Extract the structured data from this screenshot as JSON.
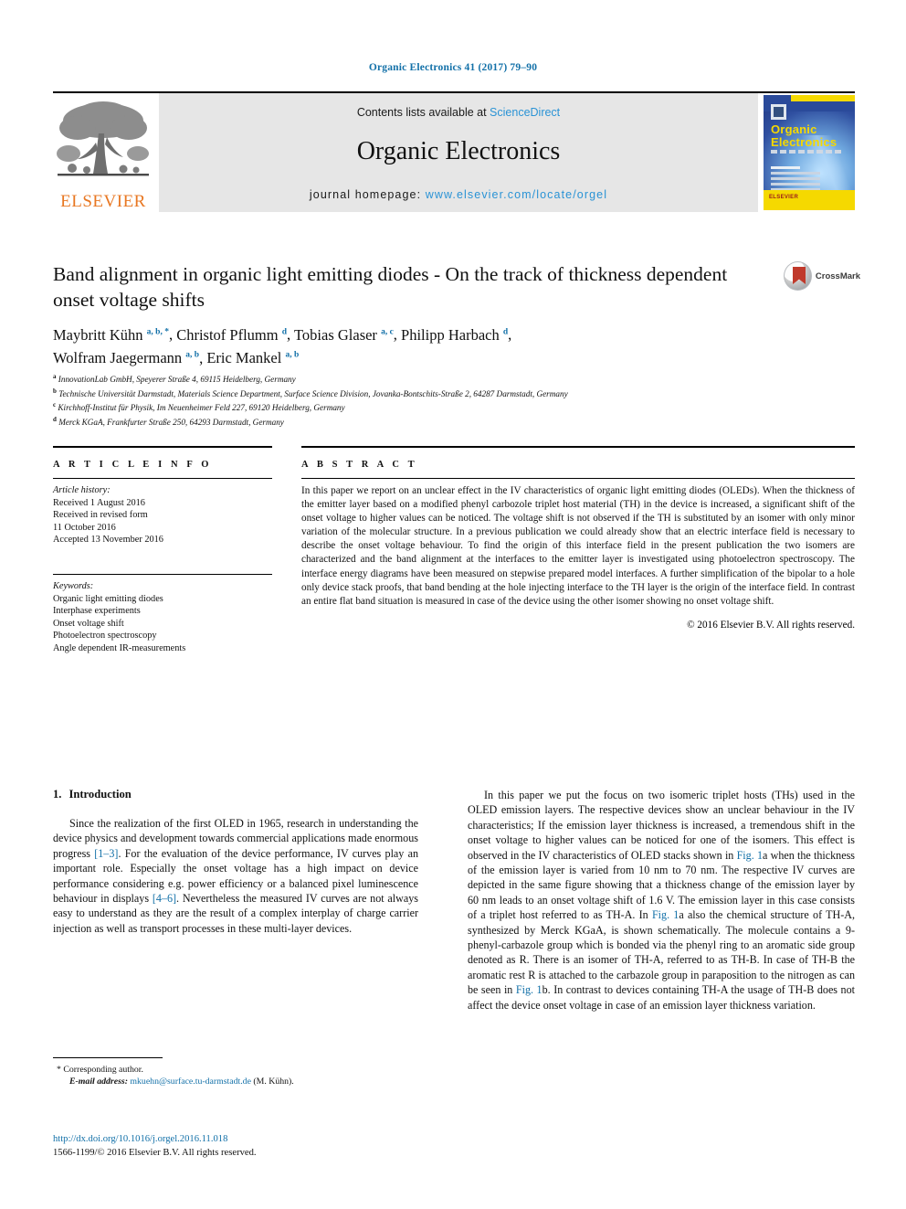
{
  "running_head": "Organic Electronics 41 (2017) 79–90",
  "masthead": {
    "publisher": "ELSEVIER",
    "contents_prefix": "Contents lists available at ",
    "contents_link": "ScienceDirect",
    "journal_name": "Organic Electronics",
    "homepage_prefix": "journal homepage: ",
    "homepage_url": "www.elsevier.com/locate/orgel",
    "cover": {
      "line1": "Organic",
      "line2": "Electronics",
      "bottom_text": "ELSEVIER"
    }
  },
  "article": {
    "title": "Band alignment in organic light emitting diodes - On the track of thickness dependent onset voltage shifts",
    "crossmark_label": "CrossMark",
    "authors": [
      {
        "name": "Maybritt Kühn",
        "marks": "a, b, *"
      },
      {
        "name": "Christof Pflumm",
        "marks": "d"
      },
      {
        "name": "Tobias Glaser",
        "marks": "a, c"
      },
      {
        "name": "Philipp Harbach",
        "marks": "d"
      },
      {
        "name": "Wolfram Jaegermann",
        "marks": "a, b"
      },
      {
        "name": "Eric Mankel",
        "marks": "a, b"
      }
    ],
    "affiliations": [
      {
        "mark": "a",
        "text": "InnovationLab GmbH, Speyerer Straße 4, 69115 Heidelberg, Germany"
      },
      {
        "mark": "b",
        "text": "Technische Universität Darmstadt, Materials Science Department, Surface Science Division, Jovanka-Bontschits-Straße 2, 64287 Darmstadt, Germany"
      },
      {
        "mark": "c",
        "text": "Kirchhoff-Institut für Physik, Im Neuenheimer Feld 227, 69120 Heidelberg, Germany"
      },
      {
        "mark": "d",
        "text": "Merck KGaA, Frankfurter Straße 250, 64293 Darmstadt, Germany"
      }
    ]
  },
  "article_info": {
    "heading": "A R T I C L E  I N F O",
    "history_label": "Article history:",
    "history": [
      "Received 1 August 2016",
      "Received in revised form",
      "11 October 2016",
      "Accepted 13 November 2016"
    ],
    "keywords_label": "Keywords:",
    "keywords": [
      "Organic light emitting diodes",
      "Interphase experiments",
      "Onset voltage shift",
      "Photoelectron spectroscopy",
      "Angle dependent IR-measurements"
    ]
  },
  "abstract": {
    "heading": "A B S T R A C T",
    "text": "In this paper we report on an unclear effect in the IV characteristics of organic light emitting diodes (OLEDs). When the thickness of the emitter layer based on a modified phenyl carbozole triplet host material (TH) in the device is increased, a significant shift of the onset voltage to higher values can be noticed. The voltage shift is not observed if the TH is substituted by an isomer with only minor variation of the molecular structure. In a previous publication we could already show that an electric interface field is necessary to describe the onset voltage behaviour. To find the origin of this interface field in the present publication the two isomers are characterized and the band alignment at the interfaces to the emitter layer is investigated using photoelectron spectroscopy. The interface energy diagrams have been measured on stepwise prepared model interfaces. A further simplification of the bipolar to a hole only device stack proofs, that band bending at the hole injecting interface to the TH layer is the origin of the interface field. In contrast an entire flat band situation is measured in case of the device using the other isomer showing no onset voltage shift.",
    "copyright": "© 2016 Elsevier B.V. All rights reserved."
  },
  "sections": {
    "intro_number": "1.",
    "intro_title": "Introduction",
    "left_paragraph_part1": "Since the realization of the first OLED in 1965, research in understanding the device physics and development towards commercial applications made enormous progress ",
    "left_ref1": "[1–3]",
    "left_paragraph_part2": ". For the evaluation of the device performance, IV curves play an important role. Especially the onset voltage has a high impact on device performance considering e.g. power efficiency or a balanced pixel luminescence behaviour in displays ",
    "left_ref2": "[4–6]",
    "left_paragraph_part3": ". Nevertheless the measured IV curves are not always easy to understand as they are the result of a complex interplay of charge carrier injection as well as transport processes in these multi-layer devices.",
    "right_p1": "In this paper we put the focus on two isomeric triplet hosts (THs) used in the OLED emission layers. The respective devices show an unclear behaviour in the IV characteristics; If the emission layer thickness is increased, a tremendous shift in the onset voltage to higher values can be noticed for one of the isomers. This effect is observed in the IV characteristics of OLED stacks shown in ",
    "right_fig1a": "Fig. 1",
    "right_p2": "a when the thickness of the emission layer is varied from 10 nm to 70 nm. The respective IV curves are depicted in the same figure showing that a thickness change of the emission layer by 60 nm leads to an onset voltage shift of 1.6 V. The emission layer in this case consists of a triplet host referred to as TH-A. In ",
    "right_fig1a2": "Fig. 1",
    "right_p3": "a also the chemical structure of TH-A, synthesized by Merck KGaA, is shown schematically. The molecule contains a 9-phenyl-carbazole group which is bonded via the phenyl ring to an aromatic side group denoted as R. There is an isomer of TH-A, referred to as TH-B. In case of TH-B the aromatic rest R is attached to the carbazole group in paraposition to the nitrogen as can be seen in ",
    "right_fig1b": "Fig. 1",
    "right_p4": "b. In contrast to devices containing TH-A the usage of TH-B does not affect the device onset voltage in case of an emission layer thickness variation."
  },
  "footer": {
    "corresponding_mark": "*",
    "corresponding_label": "Corresponding author.",
    "email_label": "E-mail address:",
    "email": "mkuehn@surface.tu-darmstadt.de",
    "email_suffix": "(M. Kühn).",
    "doi": "http://dx.doi.org/10.1016/j.orgel.2016.11.018",
    "issn_line": "1566-1199/© 2016 Elsevier B.V. All rights reserved."
  },
  "colors": {
    "link": "#1270a8",
    "sciencedirect": "#2a93d5",
    "elsevier_orange": "#e87722",
    "cover_blue": "#2a4a9a",
    "cover_yellow": "#f5d900"
  }
}
